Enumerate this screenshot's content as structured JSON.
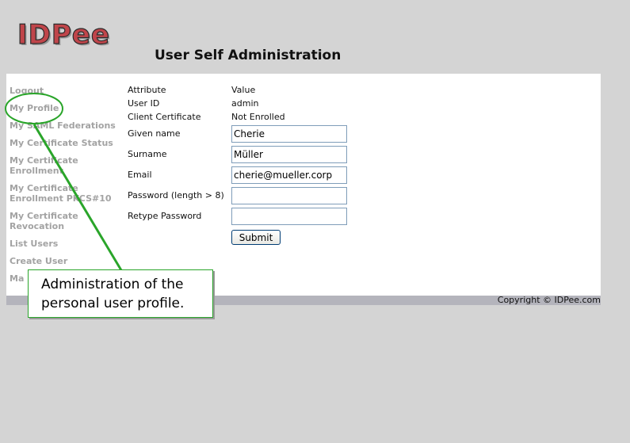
{
  "logo": {
    "text": "IDPee"
  },
  "page_title": "User Self Administration",
  "nav": {
    "items": [
      {
        "label": "Logout"
      },
      {
        "label": "My Profile"
      },
      {
        "label": "My SAML Federations"
      },
      {
        "label": "My Certificate Status"
      },
      {
        "label": "My Certificate Enrollment"
      },
      {
        "label": "My Certificate Enrollment PKCS#10"
      },
      {
        "label": "My Certificate Revocation"
      },
      {
        "label": "List Users"
      },
      {
        "label": "Create User"
      },
      {
        "label": "Ma"
      }
    ]
  },
  "profile": {
    "header_attribute": "Attribute",
    "header_value": "Value",
    "user_id_label": "User ID",
    "user_id_value": "admin",
    "client_cert_label": "Client Certificate",
    "client_cert_value": "Not Enrolled",
    "given_name_label": "Given name",
    "given_name_value": "Cherie",
    "surname_label": "Surname",
    "surname_value": "Müller",
    "email_label": "Email",
    "email_value": "cherie@mueller.corp",
    "password_label": "Password (length > 8)",
    "password_value": "",
    "retype_label": "Retype Password",
    "retype_value": "",
    "submit_label": "Submit"
  },
  "footer": {
    "copyright": "Copyright © IDPee.com"
  },
  "callout": {
    "line1": "Administration of the",
    "line2": "personal user profile."
  },
  "colors": {
    "background": "#d4d4d4",
    "panel": "#ffffff",
    "nav_text": "#a3a3a3",
    "callout_green": "#2aa52a",
    "logo_red": "#c0454a"
  }
}
